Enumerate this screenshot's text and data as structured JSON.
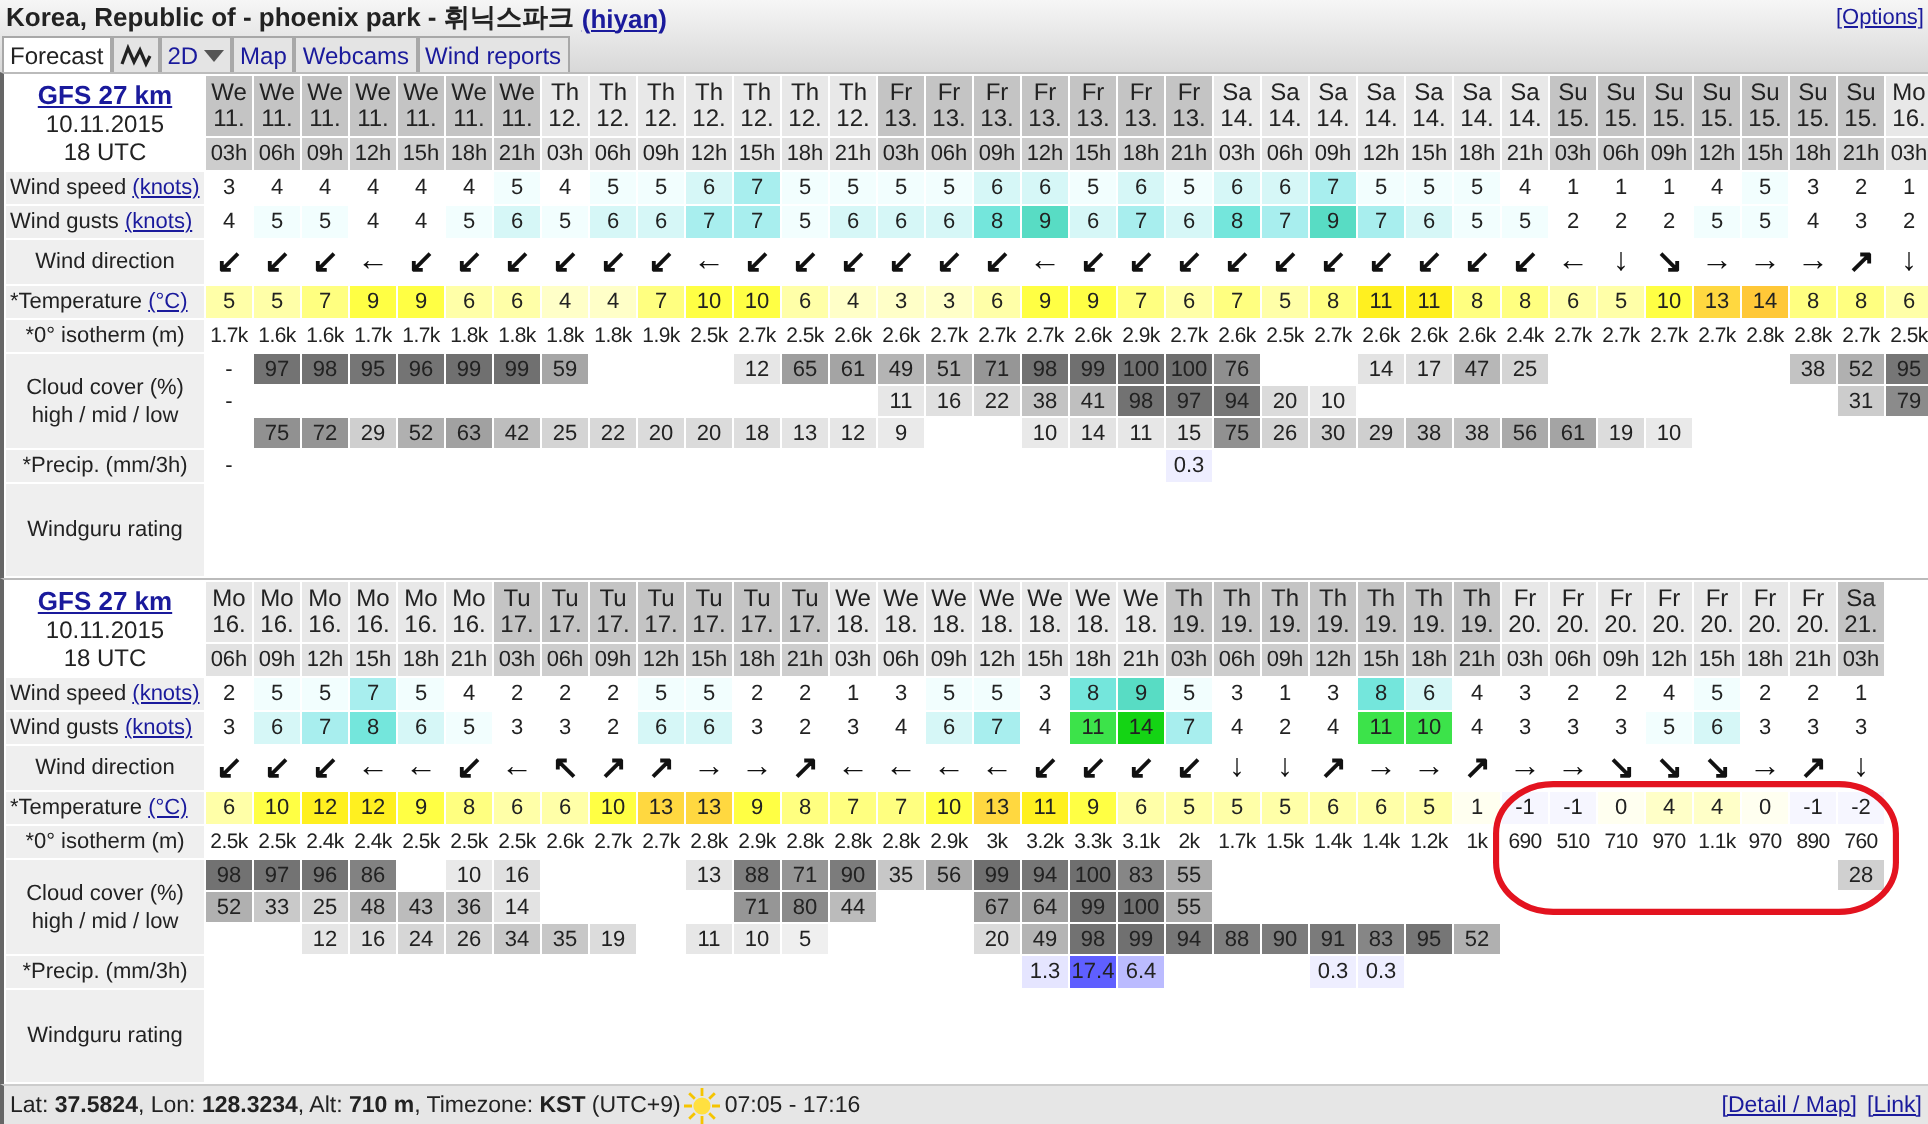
{
  "header": {
    "location": "Korea, Republic of - phoenix park - 휘닉스파크",
    "user_link": "(hiyan)",
    "options_link": "[Options]"
  },
  "tabs": [
    {
      "kind": "text",
      "label": "Forecast",
      "selected": true
    },
    {
      "kind": "graph",
      "selected": false
    },
    {
      "kind": "dropdown",
      "label": "2D",
      "selected": false
    },
    {
      "kind": "text",
      "label": "Map",
      "selected": false
    },
    {
      "kind": "text",
      "label": "Webcams",
      "selected": false
    },
    {
      "kind": "text",
      "label": "Wind reports",
      "selected": false
    }
  ],
  "forecasts": [
    {
      "model_link": "GFS 27 km",
      "date": "10.11.2015",
      "run": "18 UTC",
      "row_labels": {
        "speed": "Wind speed",
        "speed_unit": "(knots)",
        "gust": "Wind gusts",
        "gust_unit": "(knots)",
        "direction": "Wind direction",
        "temp": "*Temperature",
        "temp_unit": "(°C)",
        "isotherm": "*0° isotherm (m)",
        "cloud": "Cloud cover (%)",
        "cloud_sub": "high / mid / low",
        "precip": "*Precip. (mm/3h)",
        "rating": "Windguru rating"
      },
      "columns": [
        {
          "day": "We",
          "date": "11.",
          "hour": "03h",
          "shaded": true,
          "speed": "3",
          "gust": "4",
          "direction": "↙",
          "temp": "5",
          "isotherm": "1.7k",
          "cloud_high": "-",
          "cloud_mid": "-",
          "precip": "-"
        },
        {
          "day": "We",
          "date": "11.",
          "hour": "06h",
          "shaded": true,
          "speed": "4",
          "gust": "5",
          "direction": "↙",
          "temp": "5",
          "isotherm": "1.6k",
          "cloud_high": "97",
          "cloud_low": "75"
        },
        {
          "day": "We",
          "date": "11.",
          "hour": "09h",
          "shaded": true,
          "speed": "4",
          "gust": "5",
          "direction": "↙",
          "temp": "7",
          "isotherm": "1.6k",
          "cloud_high": "98",
          "cloud_low": "72"
        },
        {
          "day": "We",
          "date": "11.",
          "hour": "12h",
          "shaded": true,
          "speed": "4",
          "gust": "4",
          "direction": "←",
          "temp": "9",
          "isotherm": "1.7k",
          "cloud_high": "95",
          "cloud_low": "29"
        },
        {
          "day": "We",
          "date": "11.",
          "hour": "15h",
          "shaded": true,
          "speed": "4",
          "gust": "4",
          "direction": "↙",
          "temp": "9",
          "isotherm": "1.7k",
          "cloud_high": "96",
          "cloud_low": "52"
        },
        {
          "day": "We",
          "date": "11.",
          "hour": "18h",
          "shaded": true,
          "speed": "4",
          "gust": "5",
          "direction": "↙",
          "temp": "6",
          "isotherm": "1.8k",
          "cloud_high": "99",
          "cloud_low": "63"
        },
        {
          "day": "We",
          "date": "11.",
          "hour": "21h",
          "shaded": true,
          "speed": "5",
          "gust": "6",
          "direction": "↙",
          "temp": "6",
          "isotherm": "1.8k",
          "cloud_high": "99",
          "cloud_low": "42"
        },
        {
          "day": "Th",
          "date": "12.",
          "hour": "03h",
          "shaded": false,
          "speed": "4",
          "gust": "5",
          "direction": "↙",
          "temp": "4",
          "isotherm": "1.8k",
          "cloud_high": "59",
          "cloud_low": "25"
        },
        {
          "day": "Th",
          "date": "12.",
          "hour": "06h",
          "shaded": false,
          "speed": "5",
          "gust": "6",
          "direction": "↙",
          "temp": "4",
          "isotherm": "1.8k",
          "cloud_low": "22"
        },
        {
          "day": "Th",
          "date": "12.",
          "hour": "09h",
          "shaded": false,
          "speed": "5",
          "gust": "6",
          "direction": "↙",
          "temp": "7",
          "isotherm": "1.9k",
          "cloud_low": "20"
        },
        {
          "day": "Th",
          "date": "12.",
          "hour": "12h",
          "shaded": false,
          "speed": "6",
          "gust": "7",
          "direction": "←",
          "temp": "10",
          "isotherm": "2.5k",
          "cloud_low": "20"
        },
        {
          "day": "Th",
          "date": "12.",
          "hour": "15h",
          "shaded": false,
          "speed": "7",
          "gust": "7",
          "direction": "↙",
          "temp": "10",
          "isotherm": "2.7k",
          "cloud_high": "12",
          "cloud_low": "18"
        },
        {
          "day": "Th",
          "date": "12.",
          "hour": "18h",
          "shaded": false,
          "speed": "5",
          "gust": "5",
          "direction": "↙",
          "temp": "6",
          "isotherm": "2.5k",
          "cloud_high": "65",
          "cloud_low": "13"
        },
        {
          "day": "Th",
          "date": "12.",
          "hour": "21h",
          "shaded": false,
          "speed": "5",
          "gust": "6",
          "direction": "↙",
          "temp": "4",
          "isotherm": "2.6k",
          "cloud_high": "61",
          "cloud_low": "12"
        },
        {
          "day": "Fr",
          "date": "13.",
          "hour": "03h",
          "shaded": true,
          "speed": "5",
          "gust": "6",
          "direction": "↙",
          "temp": "3",
          "isotherm": "2.6k",
          "cloud_high": "49",
          "cloud_mid": "11",
          "cloud_low": "9"
        },
        {
          "day": "Fr",
          "date": "13.",
          "hour": "06h",
          "shaded": true,
          "speed": "5",
          "gust": "6",
          "direction": "↙",
          "temp": "3",
          "isotherm": "2.7k",
          "cloud_high": "51",
          "cloud_mid": "16"
        },
        {
          "day": "Fr",
          "date": "13.",
          "hour": "09h",
          "shaded": true,
          "speed": "6",
          "gust": "8",
          "direction": "↙",
          "temp": "6",
          "isotherm": "2.7k",
          "cloud_high": "71",
          "cloud_mid": "22"
        },
        {
          "day": "Fr",
          "date": "13.",
          "hour": "12h",
          "shaded": true,
          "speed": "6",
          "gust": "9",
          "direction": "←",
          "temp": "9",
          "isotherm": "2.7k",
          "cloud_high": "98",
          "cloud_mid": "38",
          "cloud_low": "10"
        },
        {
          "day": "Fr",
          "date": "13.",
          "hour": "15h",
          "shaded": true,
          "speed": "5",
          "gust": "6",
          "direction": "↙",
          "temp": "9",
          "isotherm": "2.6k",
          "cloud_high": "99",
          "cloud_mid": "41",
          "cloud_low": "14"
        },
        {
          "day": "Fr",
          "date": "13.",
          "hour": "18h",
          "shaded": true,
          "speed": "6",
          "gust": "7",
          "direction": "↙",
          "temp": "7",
          "isotherm": "2.9k",
          "cloud_high": "100",
          "cloud_mid": "98",
          "cloud_low": "11"
        },
        {
          "day": "Fr",
          "date": "13.",
          "hour": "21h",
          "shaded": true,
          "speed": "5",
          "gust": "6",
          "direction": "↙",
          "temp": "6",
          "isotherm": "2.7k",
          "cloud_high": "100",
          "cloud_mid": "97",
          "cloud_low": "15",
          "precip": "0.3"
        },
        {
          "day": "Sa",
          "date": "14.",
          "hour": "03h",
          "shaded": false,
          "speed": "6",
          "gust": "8",
          "direction": "↙",
          "temp": "7",
          "isotherm": "2.6k",
          "cloud_high": "76",
          "cloud_mid": "94",
          "cloud_low": "75"
        },
        {
          "day": "Sa",
          "date": "14.",
          "hour": "06h",
          "shaded": false,
          "speed": "6",
          "gust": "7",
          "direction": "↙",
          "temp": "5",
          "isotherm": "2.5k",
          "cloud_mid": "20",
          "cloud_low": "26"
        },
        {
          "day": "Sa",
          "date": "14.",
          "hour": "09h",
          "shaded": false,
          "speed": "7",
          "gust": "9",
          "direction": "↙",
          "temp": "8",
          "isotherm": "2.7k",
          "cloud_mid": "10",
          "cloud_low": "30"
        },
        {
          "day": "Sa",
          "date": "14.",
          "hour": "12h",
          "shaded": false,
          "speed": "5",
          "gust": "7",
          "direction": "↙",
          "temp": "11",
          "isotherm": "2.6k",
          "cloud_high": "14",
          "cloud_low": "29"
        },
        {
          "day": "Sa",
          "date": "14.",
          "hour": "15h",
          "shaded": false,
          "speed": "5",
          "gust": "6",
          "direction": "↙",
          "temp": "11",
          "isotherm": "2.6k",
          "cloud_high": "17",
          "cloud_low": "38"
        },
        {
          "day": "Sa",
          "date": "14.",
          "hour": "18h",
          "shaded": false,
          "speed": "5",
          "gust": "5",
          "direction": "↙",
          "temp": "8",
          "isotherm": "2.6k",
          "cloud_high": "47",
          "cloud_low": "38"
        },
        {
          "day": "Sa",
          "date": "14.",
          "hour": "21h",
          "shaded": false,
          "speed": "4",
          "gust": "5",
          "direction": "↙",
          "temp": "8",
          "isotherm": "2.4k",
          "cloud_high": "25",
          "cloud_low": "56"
        },
        {
          "day": "Su",
          "date": "15.",
          "hour": "03h",
          "shaded": true,
          "speed": "1",
          "gust": "2",
          "direction": "←",
          "temp": "6",
          "isotherm": "2.7k",
          "cloud_low": "61"
        },
        {
          "day": "Su",
          "date": "15.",
          "hour": "06h",
          "shaded": true,
          "speed": "1",
          "gust": "2",
          "direction": "↓",
          "temp": "5",
          "isotherm": "2.7k",
          "cloud_low": "19"
        },
        {
          "day": "Su",
          "date": "15.",
          "hour": "09h",
          "shaded": true,
          "speed": "1",
          "gust": "2",
          "direction": "↘",
          "temp": "10",
          "isotherm": "2.7k",
          "cloud_low": "10"
        },
        {
          "day": "Su",
          "date": "15.",
          "hour": "12h",
          "shaded": true,
          "speed": "4",
          "gust": "5",
          "direction": "→",
          "temp": "13",
          "isotherm": "2.7k"
        },
        {
          "day": "Su",
          "date": "15.",
          "hour": "15h",
          "shaded": true,
          "speed": "5",
          "gust": "5",
          "direction": "→",
          "temp": "14",
          "isotherm": "2.8k"
        },
        {
          "day": "Su",
          "date": "15.",
          "hour": "18h",
          "shaded": true,
          "speed": "3",
          "gust": "4",
          "direction": "→",
          "temp": "8",
          "isotherm": "2.8k",
          "cloud_high": "38"
        },
        {
          "day": "Su",
          "date": "15.",
          "hour": "21h",
          "shaded": true,
          "speed": "2",
          "gust": "3",
          "direction": "↗",
          "temp": "8",
          "isotherm": "2.7k",
          "cloud_high": "52",
          "cloud_mid": "31"
        },
        {
          "day": "Mo",
          "date": "16.",
          "hour": "03h",
          "shaded": false,
          "speed": "1",
          "gust": "2",
          "direction": "↓",
          "temp": "6",
          "isotherm": "2.5k",
          "cloud_high": "95",
          "cloud_mid": "79"
        }
      ]
    },
    {
      "model_link": "GFS 27 km",
      "date": "10.11.2015",
      "run": "18 UTC",
      "row_labels": {
        "speed": "Wind speed",
        "speed_unit": "(knots)",
        "gust": "Wind gusts",
        "gust_unit": "(knots)",
        "direction": "Wind direction",
        "temp": "*Temperature",
        "temp_unit": "(°C)",
        "isotherm": "*0° isotherm (m)",
        "cloud": "Cloud cover (%)",
        "cloud_sub": "high / mid / low",
        "precip": "*Precip. (mm/3h)",
        "rating": "Windguru rating"
      },
      "columns": [
        {
          "day": "Mo",
          "date": "16.",
          "hour": "06h",
          "shaded": false,
          "speed": "2",
          "gust": "3",
          "direction": "↙",
          "temp": "6",
          "isotherm": "2.5k",
          "cloud_high": "98",
          "cloud_mid": "52"
        },
        {
          "day": "Mo",
          "date": "16.",
          "hour": "09h",
          "shaded": false,
          "speed": "5",
          "gust": "6",
          "direction": "↙",
          "temp": "10",
          "isotherm": "2.5k",
          "cloud_high": "97",
          "cloud_mid": "33"
        },
        {
          "day": "Mo",
          "date": "16.",
          "hour": "12h",
          "shaded": false,
          "speed": "5",
          "gust": "7",
          "direction": "↙",
          "temp": "12",
          "isotherm": "2.4k",
          "cloud_high": "96",
          "cloud_mid": "25",
          "cloud_low": "12"
        },
        {
          "day": "Mo",
          "date": "16.",
          "hour": "15h",
          "shaded": false,
          "speed": "7",
          "gust": "8",
          "direction": "←",
          "temp": "12",
          "isotherm": "2.4k",
          "cloud_high": "86",
          "cloud_mid": "48",
          "cloud_low": "16"
        },
        {
          "day": "Mo",
          "date": "16.",
          "hour": "18h",
          "shaded": false,
          "speed": "5",
          "gust": "6",
          "direction": "←",
          "temp": "9",
          "isotherm": "2.5k",
          "cloud_mid": "43",
          "cloud_low": "24"
        },
        {
          "day": "Mo",
          "date": "16.",
          "hour": "21h",
          "shaded": false,
          "speed": "4",
          "gust": "5",
          "direction": "↙",
          "temp": "8",
          "isotherm": "2.5k",
          "cloud_high": "10",
          "cloud_mid": "36",
          "cloud_low": "26"
        },
        {
          "day": "Tu",
          "date": "17.",
          "hour": "03h",
          "shaded": true,
          "speed": "2",
          "gust": "3",
          "direction": "←",
          "temp": "6",
          "isotherm": "2.5k",
          "cloud_high": "16",
          "cloud_mid": "14",
          "cloud_low": "34"
        },
        {
          "day": "Tu",
          "date": "17.",
          "hour": "06h",
          "shaded": true,
          "speed": "2",
          "gust": "3",
          "direction": "↖",
          "temp": "6",
          "isotherm": "2.6k",
          "cloud_low": "35"
        },
        {
          "day": "Tu",
          "date": "17.",
          "hour": "09h",
          "shaded": true,
          "speed": "2",
          "gust": "2",
          "direction": "↗",
          "temp": "10",
          "isotherm": "2.7k",
          "cloud_low": "19"
        },
        {
          "day": "Tu",
          "date": "17.",
          "hour": "12h",
          "shaded": true,
          "speed": "5",
          "gust": "6",
          "direction": "↗",
          "temp": "13",
          "isotherm": "2.7k"
        },
        {
          "day": "Tu",
          "date": "17.",
          "hour": "15h",
          "shaded": true,
          "speed": "5",
          "gust": "6",
          "direction": "→",
          "temp": "13",
          "isotherm": "2.8k",
          "cloud_high": "13",
          "cloud_low": "11"
        },
        {
          "day": "Tu",
          "date": "17.",
          "hour": "18h",
          "shaded": true,
          "speed": "2",
          "gust": "3",
          "direction": "→",
          "temp": "9",
          "isotherm": "2.9k",
          "cloud_high": "88",
          "cloud_mid": "71",
          "cloud_low": "10"
        },
        {
          "day": "Tu",
          "date": "17.",
          "hour": "21h",
          "shaded": true,
          "speed": "2",
          "gust": "2",
          "direction": "↗",
          "temp": "8",
          "isotherm": "2.8k",
          "cloud_high": "71",
          "cloud_mid": "80",
          "cloud_low": "5"
        },
        {
          "day": "We",
          "date": "18.",
          "hour": "03h",
          "shaded": false,
          "speed": "1",
          "gust": "3",
          "direction": "←",
          "temp": "7",
          "isotherm": "2.8k",
          "cloud_high": "90",
          "cloud_mid": "44"
        },
        {
          "day": "We",
          "date": "18.",
          "hour": "06h",
          "shaded": false,
          "speed": "3",
          "gust": "4",
          "direction": "←",
          "temp": "7",
          "isotherm": "2.8k",
          "cloud_high": "35"
        },
        {
          "day": "We",
          "date": "18.",
          "hour": "09h",
          "shaded": false,
          "speed": "5",
          "gust": "6",
          "direction": "←",
          "temp": "10",
          "isotherm": "2.9k",
          "cloud_high": "56"
        },
        {
          "day": "We",
          "date": "18.",
          "hour": "12h",
          "shaded": false,
          "speed": "5",
          "gust": "7",
          "direction": "←",
          "temp": "13",
          "isotherm": "3k",
          "cloud_high": "99",
          "cloud_mid": "67",
          "cloud_low": "20"
        },
        {
          "day": "We",
          "date": "18.",
          "hour": "15h",
          "shaded": false,
          "speed": "3",
          "gust": "4",
          "direction": "↙",
          "temp": "11",
          "isotherm": "3.2k",
          "cloud_high": "94",
          "cloud_mid": "64",
          "cloud_low": "49",
          "precip": "1.3"
        },
        {
          "day": "We",
          "date": "18.",
          "hour": "18h",
          "shaded": false,
          "speed": "8",
          "gust": "11",
          "direction": "↙",
          "temp": "9",
          "isotherm": "3.3k",
          "cloud_high": "100",
          "cloud_mid": "99",
          "cloud_low": "98",
          "precip": "17.4"
        },
        {
          "day": "We",
          "date": "18.",
          "hour": "21h",
          "shaded": false,
          "speed": "9",
          "gust": "14",
          "direction": "↙",
          "temp": "6",
          "isotherm": "3.1k",
          "cloud_high": "83",
          "cloud_mid": "100",
          "cloud_low": "99",
          "precip": "6.4"
        },
        {
          "day": "Th",
          "date": "19.",
          "hour": "03h",
          "shaded": true,
          "speed": "5",
          "gust": "7",
          "direction": "↙",
          "temp": "5",
          "isotherm": "2k",
          "cloud_high": "55",
          "cloud_mid": "55",
          "cloud_low": "94"
        },
        {
          "day": "Th",
          "date": "19.",
          "hour": "06h",
          "shaded": true,
          "speed": "3",
          "gust": "4",
          "direction": "↓",
          "temp": "5",
          "isotherm": "1.7k",
          "cloud_low": "88"
        },
        {
          "day": "Th",
          "date": "19.",
          "hour": "09h",
          "shaded": true,
          "speed": "1",
          "gust": "2",
          "direction": "↓",
          "temp": "5",
          "isotherm": "1.5k",
          "cloud_low": "90"
        },
        {
          "day": "Th",
          "date": "19.",
          "hour": "12h",
          "shaded": true,
          "speed": "3",
          "gust": "4",
          "direction": "↗",
          "temp": "6",
          "isotherm": "1.4k",
          "cloud_low": "91",
          "precip": "0.3"
        },
        {
          "day": "Th",
          "date": "19.",
          "hour": "15h",
          "shaded": true,
          "speed": "8",
          "gust": "11",
          "direction": "→",
          "temp": "6",
          "isotherm": "1.4k",
          "cloud_low": "83",
          "precip": "0.3"
        },
        {
          "day": "Th",
          "date": "19.",
          "hour": "18h",
          "shaded": true,
          "speed": "6",
          "gust": "10",
          "direction": "→",
          "temp": "5",
          "isotherm": "1.2k",
          "cloud_low": "95"
        },
        {
          "day": "Th",
          "date": "19.",
          "hour": "21h",
          "shaded": true,
          "speed": "4",
          "gust": "4",
          "direction": "↗",
          "temp": "1",
          "isotherm": "1k",
          "cloud_low": "52"
        },
        {
          "day": "Fr",
          "date": "20.",
          "hour": "03h",
          "shaded": false,
          "speed": "3",
          "gust": "3",
          "direction": "→",
          "temp": "-1",
          "isotherm": "690"
        },
        {
          "day": "Fr",
          "date": "20.",
          "hour": "06h",
          "shaded": false,
          "speed": "2",
          "gust": "3",
          "direction": "→",
          "temp": "-1",
          "isotherm": "510"
        },
        {
          "day": "Fr",
          "date": "20.",
          "hour": "09h",
          "shaded": false,
          "speed": "2",
          "gust": "3",
          "direction": "↘",
          "temp": "0",
          "isotherm": "710"
        },
        {
          "day": "Fr",
          "date": "20.",
          "hour": "12h",
          "shaded": false,
          "speed": "4",
          "gust": "5",
          "direction": "↘",
          "temp": "4",
          "isotherm": "970"
        },
        {
          "day": "Fr",
          "date": "20.",
          "hour": "15h",
          "shaded": false,
          "speed": "5",
          "gust": "6",
          "direction": "↘",
          "temp": "4",
          "isotherm": "1.1k"
        },
        {
          "day": "Fr",
          "date": "20.",
          "hour": "18h",
          "shaded": false,
          "speed": "2",
          "gust": "3",
          "direction": "→",
          "temp": "0",
          "isotherm": "970"
        },
        {
          "day": "Fr",
          "date": "20.",
          "hour": "21h",
          "shaded": false,
          "speed": "2",
          "gust": "3",
          "direction": "↗",
          "temp": "-1",
          "isotherm": "890"
        },
        {
          "day": "Sa",
          "date": "21.",
          "hour": "03h",
          "shaded": true,
          "speed": "1",
          "gust": "3",
          "direction": "↓",
          "temp": "-2",
          "isotherm": "760",
          "cloud_high": "28"
        }
      ]
    }
  ],
  "footer": {
    "location": "Lat: **37.5824**, Lon: **128.3234**, Alt: **710 m**, Timezone: **KST** (UTC+9)",
    "sun_times": "07:05 - 17:16",
    "links": [
      "[Detail / Map]",
      "[Link]"
    ]
  }
}
